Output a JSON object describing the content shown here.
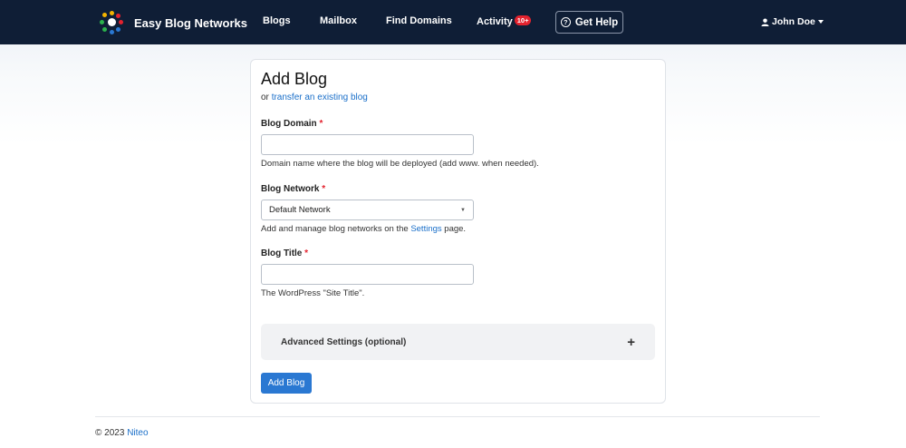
{
  "navbar": {
    "brand": "Easy Blog Networks",
    "links": [
      {
        "label": "Blogs"
      },
      {
        "label": "Mailbox"
      },
      {
        "label": "Find Domains"
      },
      {
        "label": "Activity",
        "badge": "10+"
      }
    ],
    "help_label": "Get Help",
    "user_name": "John Doe"
  },
  "form": {
    "title": "Add Blog",
    "transfer_prefix": "or",
    "transfer_link": "transfer an existing blog",
    "domain": {
      "label": "Blog Domain",
      "required_mark": "*",
      "value": "",
      "help": "Domain name where the blog will be deployed (add www. when needed)."
    },
    "network": {
      "label": "Blog Network",
      "required_mark": "*",
      "selected": "Default Network",
      "help_prefix": "Add and manage blog networks on the",
      "help_link": "Settings",
      "help_suffix": "page."
    },
    "blog_title": {
      "label": "Blog Title",
      "required_mark": "*",
      "value": "",
      "help": "The WordPress \"Site Title\"."
    },
    "advanced_label": "Advanced Settings (optional)",
    "advanced_toggle": "+",
    "submit_label": "Add Blog"
  },
  "footer": {
    "copyright": "© 2023",
    "company": "Niteo"
  },
  "colors": {
    "navbar_bg": "#0f1e36",
    "primary": "#2a78d2",
    "link": "#1a6fc9",
    "required": "#e3222e"
  }
}
